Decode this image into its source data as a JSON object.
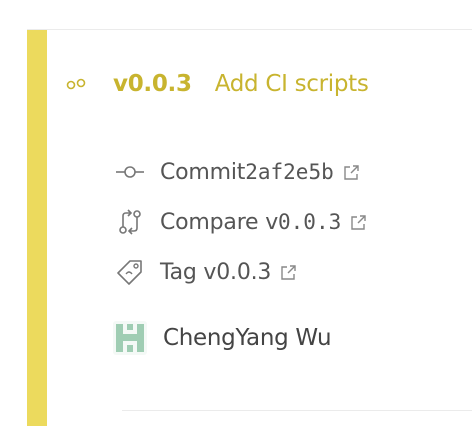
{
  "colors": {
    "accent": "#ecda5d",
    "accent_text": "#c8b42f",
    "text": "#555555",
    "avatar": "#9fcdb3"
  },
  "release": {
    "icon": "release-dots-icon",
    "version": "v0.0.3",
    "title": "Add CI scripts"
  },
  "meta": {
    "commit": {
      "icon": "commit-icon",
      "label": "Commit ",
      "value": "2af2e5b",
      "link_icon": "external-link-icon"
    },
    "compare": {
      "icon": "compare-icon",
      "label": "Compare v",
      "value": "0.0.3",
      "link_icon": "external-link-icon"
    },
    "tag": {
      "icon": "tag-icon",
      "label": "Tag v0.0.3",
      "link_icon": "external-link-icon"
    }
  },
  "author": {
    "avatar_icon": "identicon-avatar",
    "name": "ChengYang Wu"
  }
}
